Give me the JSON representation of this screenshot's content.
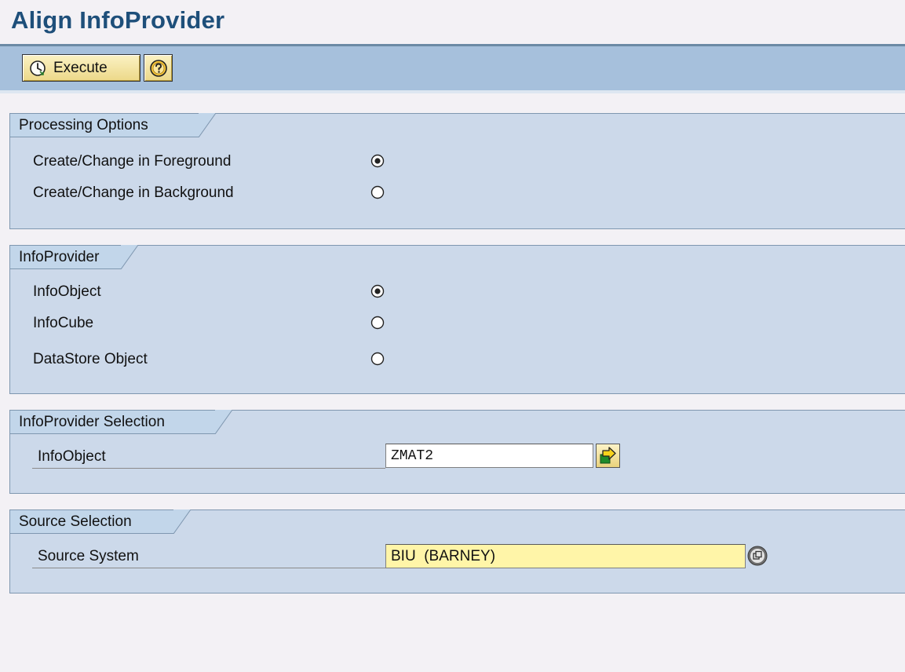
{
  "page": {
    "title": "Align InfoProvider"
  },
  "toolbar": {
    "execute_label": "Execute",
    "execute_icon": "execute-clock-icon",
    "help_icon": "help-question-icon"
  },
  "processing_options": {
    "title": "Processing Options",
    "options": [
      {
        "label": "Create/Change in Foreground",
        "selected": true
      },
      {
        "label": "Create/Change in Background",
        "selected": false
      }
    ]
  },
  "infoprovider": {
    "title": "InfoProvider",
    "options": [
      {
        "label": "InfoObject",
        "selected": true
      },
      {
        "label": "InfoCube",
        "selected": false
      },
      {
        "label": "DataStore Object",
        "selected": false
      }
    ]
  },
  "infoprovider_selection": {
    "title": "InfoProvider Selection",
    "field_label": "InfoObject",
    "field_value": "ZMAT2",
    "action_icon": "navigate-arrow-icon"
  },
  "source_selection": {
    "title": "Source Selection",
    "field_label": "Source System",
    "field_value": "BIU  (BARNEY)",
    "action_icon": "value-help-icon"
  },
  "colors": {
    "title": "#1e4f7a",
    "toolbar": "#a6c0dc",
    "group_bg": "#ccd9ea",
    "button": "#f5e6a8",
    "focused_input": "#fff5a8"
  }
}
